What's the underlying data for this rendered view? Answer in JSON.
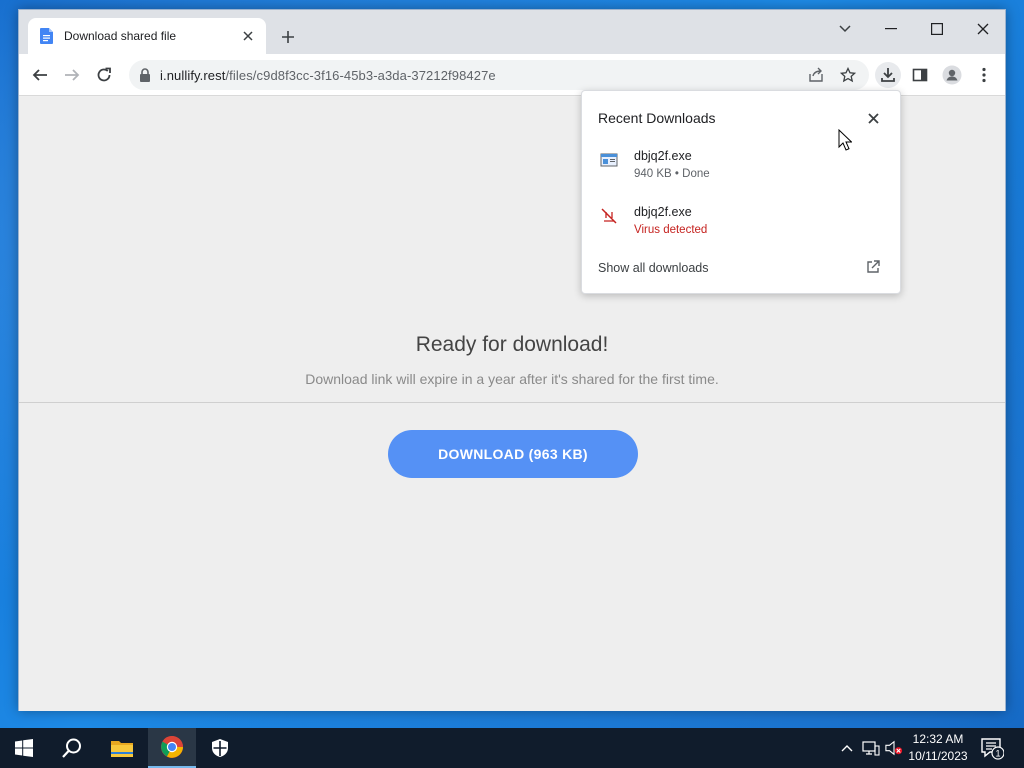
{
  "browser": {
    "tab": {
      "title": "Download shared file",
      "favicon": "docs-file-icon"
    },
    "url": {
      "domain": "i.nullify.rest",
      "path": "/files/c9d8f3cc-3f16-45b3-a3da-37212f98427e"
    },
    "icons": [
      "back-icon",
      "forward-icon",
      "reload-icon",
      "lock-icon",
      "share-icon",
      "star-icon",
      "download-icon",
      "sidepanel-icon",
      "profile-icon",
      "menu-icon"
    ]
  },
  "page": {
    "title": "Ready for download!",
    "subtitle": "Download link will expire in a year after it's shared for the first time.",
    "download_button": "DOWNLOAD (963 KB)",
    "button_color": "#5591f5"
  },
  "downloads_bubble": {
    "title": "Recent Downloads",
    "items": [
      {
        "name": "dbjq2f.exe",
        "status": "940 KB • Done",
        "icon": "exe-file-icon"
      },
      {
        "name": "dbjq2f.exe",
        "status": "Virus detected",
        "icon": "blocked-file-icon",
        "status_color": "#c5221f"
      }
    ],
    "show_all": "Show all downloads"
  },
  "taskbar": {
    "time": "12:32 AM",
    "date": "10/11/2023",
    "notification_count": "1",
    "apps": [
      "start-icon",
      "search-icon",
      "file-explorer-icon",
      "chrome-icon",
      "security-icon"
    ]
  }
}
